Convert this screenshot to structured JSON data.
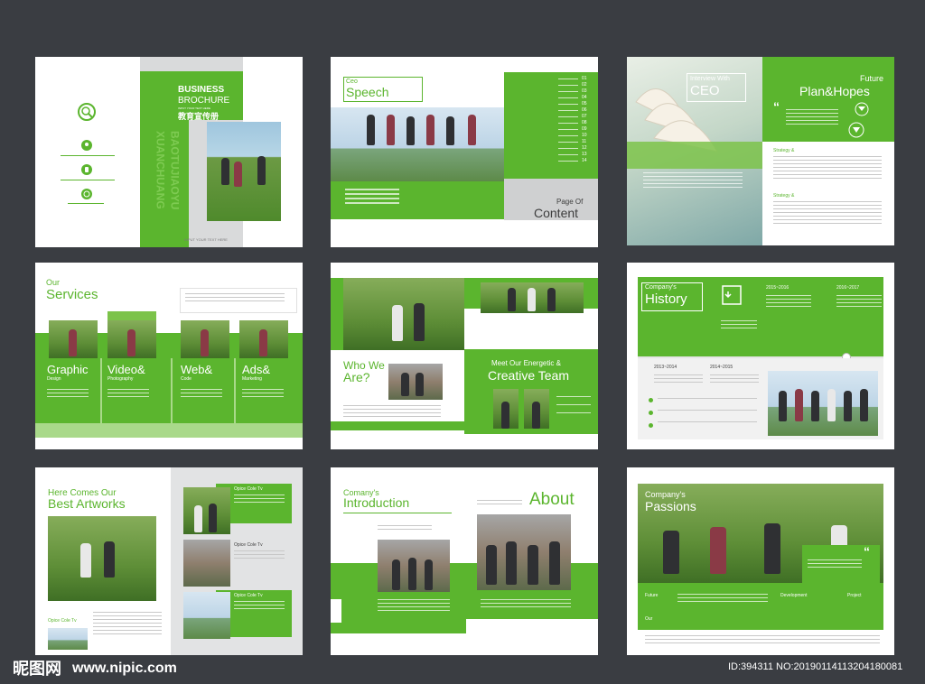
{
  "p1": {
    "title1": "BUSINESS",
    "title2": "BROCHURE",
    "sub": "INPUT YOUR TEXT HERE",
    "cn": "教育宣传册",
    "vert1": "XUANCHUANG",
    "vert2": "BAOTUJIAOYU",
    "foot": "INPUT YOUR TEXT HERE"
  },
  "p2": {
    "small": "Ceo",
    "big": "Speech",
    "page_label": "Page Of",
    "content": "Content",
    "toc_numbers": [
      "01",
      "02",
      "03",
      "04",
      "05",
      "06",
      "07",
      "08",
      "09",
      "10",
      "11",
      "12",
      "13",
      "14"
    ]
  },
  "p3": {
    "interview": "Interview With",
    "ceo": "CEO",
    "future": "Future",
    "plan": "Plan&Hopes",
    "strategy1": "Strategy &",
    "strategy2": "Strategy &"
  },
  "p4": {
    "small": "Our",
    "big": "Services",
    "items": [
      "Graphic",
      "Video&",
      "Web&",
      "Ads&"
    ],
    "subs": [
      "Design",
      "Photography",
      "Code",
      "Marketing"
    ]
  },
  "p5": {
    "who": "Who We",
    "are": "Are?",
    "meet": "Meet Our Energetic &",
    "team": "Creative Team"
  },
  "p6": {
    "small": "Company's",
    "big": "History",
    "years": [
      "2013~2014",
      "2014~2015",
      "2015~2016",
      "2016~2017"
    ]
  },
  "p7": {
    "small": "Here Comes Our",
    "big": "Best Artworks",
    "captions": [
      "Opice Cole Tv",
      "Opice Cole Tv",
      "Opice Cole Tv",
      "Opice Cole Tv"
    ]
  },
  "p8": {
    "small": "Comany's",
    "big": "Introduction",
    "about": "About"
  },
  "p9": {
    "small": "Company's",
    "big": "Passions",
    "labels": [
      "Future",
      "Development",
      "Our",
      "Project"
    ]
  },
  "footer": {
    "logo": "昵图网",
    "site": "www.nipic.com",
    "id": "ID:394311 NO:20190114113204180081"
  },
  "colors": {
    "green": "#5bb52e",
    "background": "#3a3d42"
  }
}
